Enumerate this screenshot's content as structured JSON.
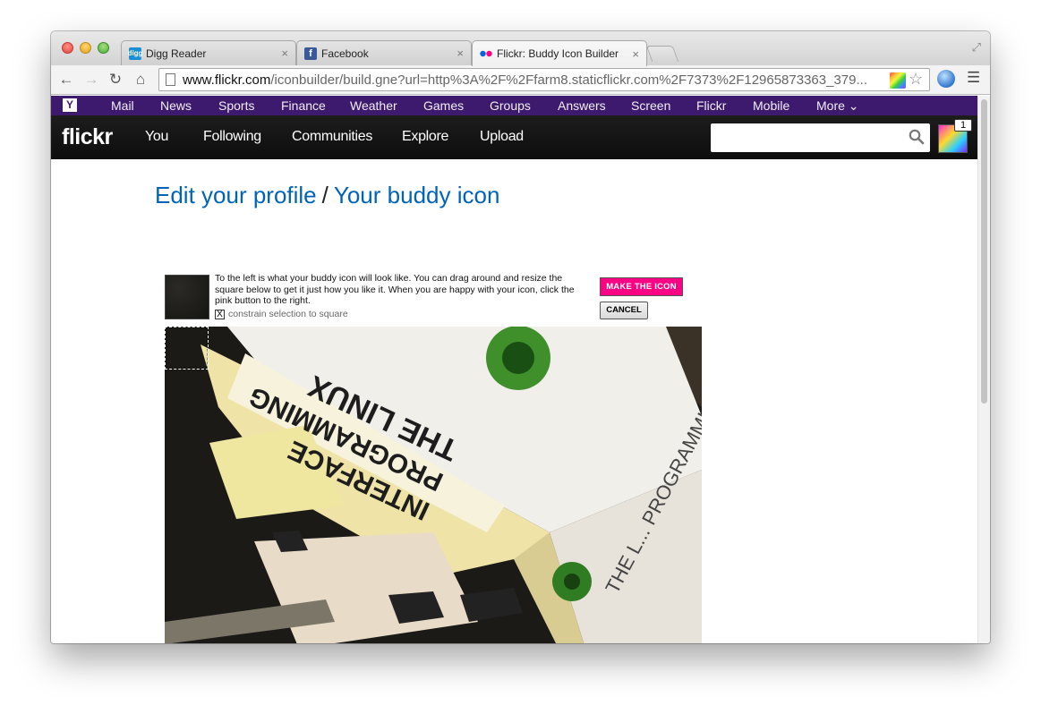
{
  "browser": {
    "tabs": [
      {
        "title": "Digg Reader",
        "favicon": "digg-icon",
        "close": "×"
      },
      {
        "title": "Facebook",
        "favicon": "facebook-icon",
        "close": "×"
      },
      {
        "title": "Flickr: Buddy Icon Builder",
        "favicon": "flickr-icon",
        "close": "×"
      }
    ],
    "url_host": "www.flickr.com",
    "url_path": "/iconbuilder/build.gne?url=http%3A%2F%2Ffarm8.staticflickr.com%2F7373%2F12965873363_379..."
  },
  "yahoo_bar": {
    "logo": "Y",
    "links": [
      "Mail",
      "News",
      "Sports",
      "Finance",
      "Weather",
      "Games",
      "Groups",
      "Answers",
      "Screen",
      "Flickr",
      "Mobile",
      "More ⌄"
    ]
  },
  "flickr_nav": {
    "logo": "flickr",
    "links": [
      "You",
      "Following",
      "Communities",
      "Explore",
      "Upload"
    ],
    "search_value": "",
    "notification_count": "1"
  },
  "page": {
    "breadcrumb_parent": "Edit your profile",
    "breadcrumb_separator": "/",
    "breadcrumb_current": "Your buddy icon",
    "instructions": "To the left is what your buddy icon will look like. You can drag around and resize the square below to get it just how you like it. When you are happy with your icon, click the pink button to the right.",
    "constrain_label": "constrain selection to square",
    "constrain_checked": true,
    "constrain_mark": "X",
    "make_icon_label": "MAKE THE ICON",
    "cancel_label": "CANCEL"
  },
  "photo": {
    "book_title_lines": [
      "THE LINUX",
      "PROGRAMMING",
      "INTERFACE"
    ],
    "book_spine": "THE L... PROGRAMMI... INTERFACE"
  },
  "colors": {
    "yahoo_purple": "#3d1a6e",
    "flickr_pink": "#ff0084",
    "link_blue": "#0063b7"
  }
}
